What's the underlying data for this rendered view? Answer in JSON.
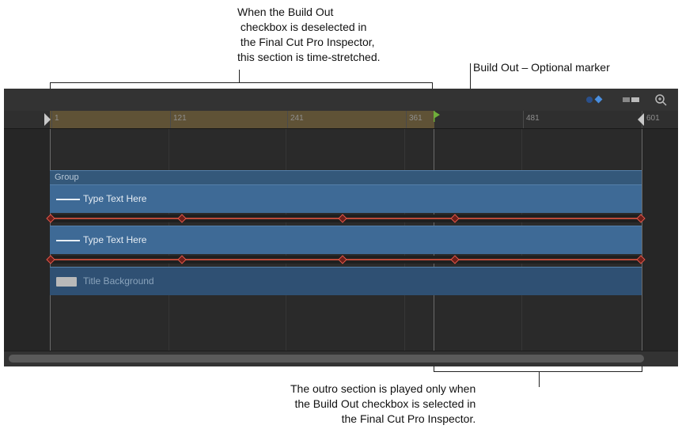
{
  "callouts": {
    "top": "When the Build Out\n checkbox is deselected in\n the Final Cut Pro Inspector,\nthis section is time-stretched.",
    "marker": "Build Out – Optional marker",
    "bottom": "The outro section is played only when\nthe Build Out checkbox is selected in\nthe Final Cut Pro Inspector."
  },
  "ruler": {
    "ticks": [
      "1",
      "121",
      "241",
      "361",
      "481",
      "601"
    ]
  },
  "timeline": {
    "group_label": "Group",
    "layers": [
      {
        "label": "Type Text Here",
        "icon": "text-line-icon"
      },
      {
        "label": "Type Text Here",
        "icon": "text-line-icon"
      },
      {
        "label": "Title Background",
        "icon": "image-thumb-icon"
      }
    ]
  },
  "toolbar": {
    "icons": [
      "keyframe-toggle-icon",
      "audio-toggle-icon",
      "zoom-icon"
    ]
  },
  "colors": {
    "accent_ruler": "#5f5236",
    "layer_bar": "#3e6a96",
    "keyframe": "#e0574a",
    "marker": "#6fae3a"
  }
}
